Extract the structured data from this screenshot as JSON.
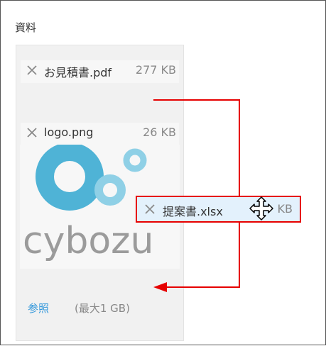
{
  "section": {
    "label": "資料"
  },
  "files": [
    {
      "name": "お見積書.pdf",
      "size": "277 KB"
    },
    {
      "name": "logo.png",
      "size": "26 KB"
    }
  ],
  "thumbnail": {
    "logo_text": "cybozu"
  },
  "dragging_file": {
    "name": "提案書.xlsx",
    "size": "KB"
  },
  "footer": {
    "browse_label": "参照",
    "max_size_label": "(最大1 GB)"
  },
  "colors": {
    "link": "#3498db",
    "annotation_red": "#e60000",
    "drag_bg": "#e3f1fc",
    "logo_blue": "#4fb3d6",
    "logo_light_blue": "#8fd0e6",
    "logo_text": "#9b9b9b"
  },
  "icons": {
    "remove": "close-icon",
    "cursor": "move-cursor-icon"
  }
}
